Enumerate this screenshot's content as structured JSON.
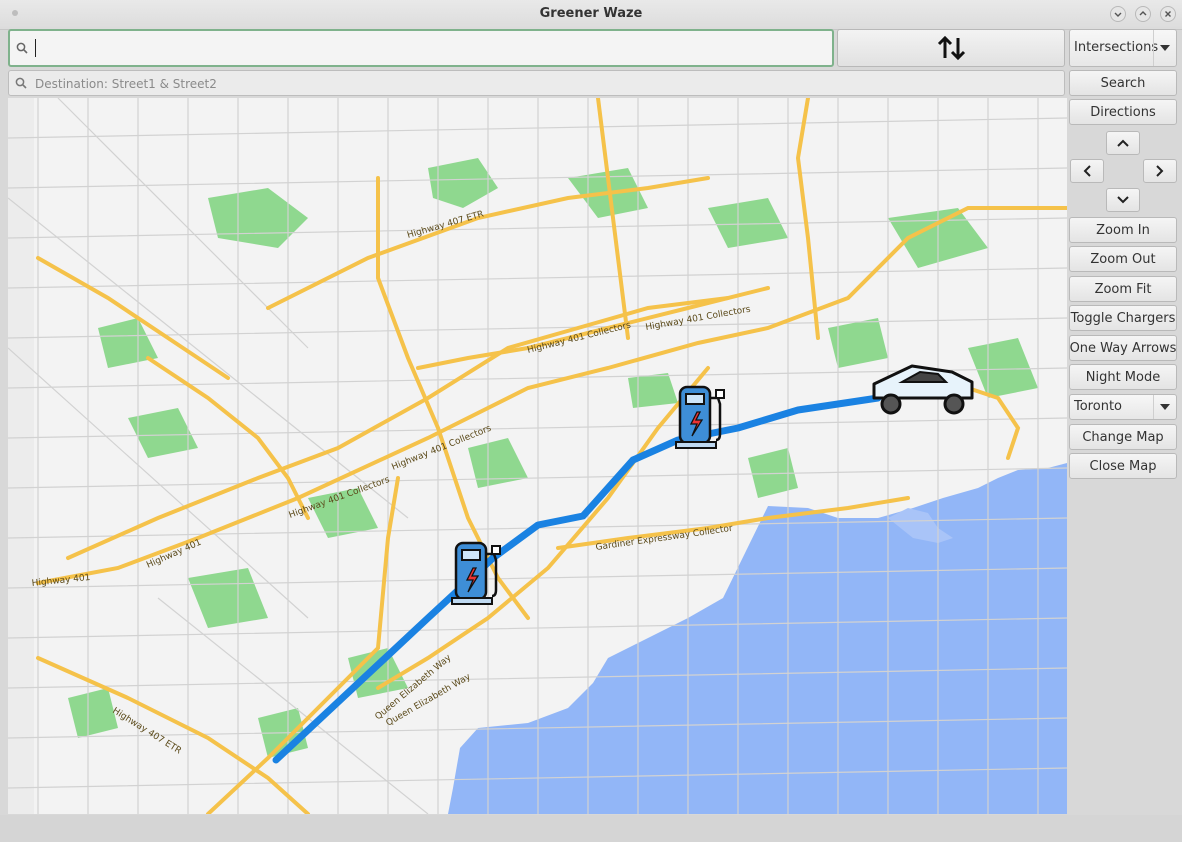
{
  "window": {
    "title": "Greener Waze"
  },
  "search": {
    "start_value": "",
    "destination_placeholder": "Destination: Street1 & Street2"
  },
  "mode_select": {
    "value": "Intersections"
  },
  "buttons": {
    "search": "Search",
    "directions": "Directions",
    "zoom_in": "Zoom In",
    "zoom_out": "Zoom Out",
    "zoom_fit": "Zoom Fit",
    "toggle_chargers": "Toggle Chargers",
    "one_way_arrows": "One Way Arrows",
    "night_mode": "Night Mode",
    "change_map": "Change Map",
    "close_map": "Close Map"
  },
  "map_select": {
    "value": "Toronto"
  },
  "map": {
    "labels": {
      "hwy407_top": "Highway 407 ETR",
      "hwy401_collectors_a": "Highway 401 Collectors",
      "hwy401_collectors_b": "Highway 401 Collectors",
      "hwy401_collectors_c": "Highway 401 Collectors",
      "hwy401_collectors_d": "Highway 401 Collectors",
      "hwy401_collectors_e": "Highway 401 Collectors",
      "hwy401_a": "Highway 401",
      "hwy401_b": "Highway 401",
      "gardiner": "Gardiner Expressway Collector",
      "queen_e_a": "Queen Elizabeth Way",
      "queen_e_b": "Queen Elizabeth Way",
      "hwy407_bottom": "Highway 407 ETR"
    },
    "colors": {
      "route": "#1a82e2",
      "water": "#92b6f7",
      "park": "#8fd88f",
      "highway": "#f5c24a",
      "road": "#cfcfcf",
      "background": "#f3f3f3"
    },
    "icons": [
      "charging-station-icon",
      "charging-station-icon",
      "car-icon"
    ]
  }
}
